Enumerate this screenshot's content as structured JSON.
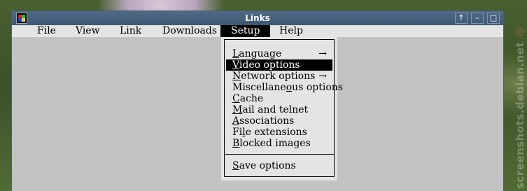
{
  "window": {
    "title": "Links",
    "buttons": [
      "↑",
      "–",
      "□",
      "×"
    ]
  },
  "menubar": {
    "items": [
      "File",
      "View",
      "Link",
      "Downloads",
      "Setup",
      "Help"
    ],
    "active": "Setup"
  },
  "setup_menu": {
    "items": [
      {
        "pre": "",
        "u": "L",
        "post": "anguage",
        "submenu": true
      },
      {
        "pre": "",
        "u": "V",
        "post": "ideo options",
        "submenu": false,
        "selected": true
      },
      {
        "pre": "",
        "u": "N",
        "post": "etwork options",
        "submenu": true
      },
      {
        "pre": "Miscellane",
        "u": "o",
        "post": "us options",
        "submenu": false
      },
      {
        "pre": "",
        "u": "C",
        "post": "ache",
        "submenu": false
      },
      {
        "pre": "",
        "u": "M",
        "post": "ail and telnet",
        "submenu": false
      },
      {
        "pre": "",
        "u": "A",
        "post": "ssociations",
        "submenu": false
      },
      {
        "pre": "Fi",
        "u": "l",
        "post": "e extensions",
        "submenu": false
      },
      {
        "pre": "",
        "u": "B",
        "post": "locked images",
        "submenu": false
      },
      {
        "pre": "",
        "u": "S",
        "post": "ave options",
        "submenu": false
      }
    ],
    "arrow": "→"
  },
  "watermark": "screenshots.debian.net"
}
